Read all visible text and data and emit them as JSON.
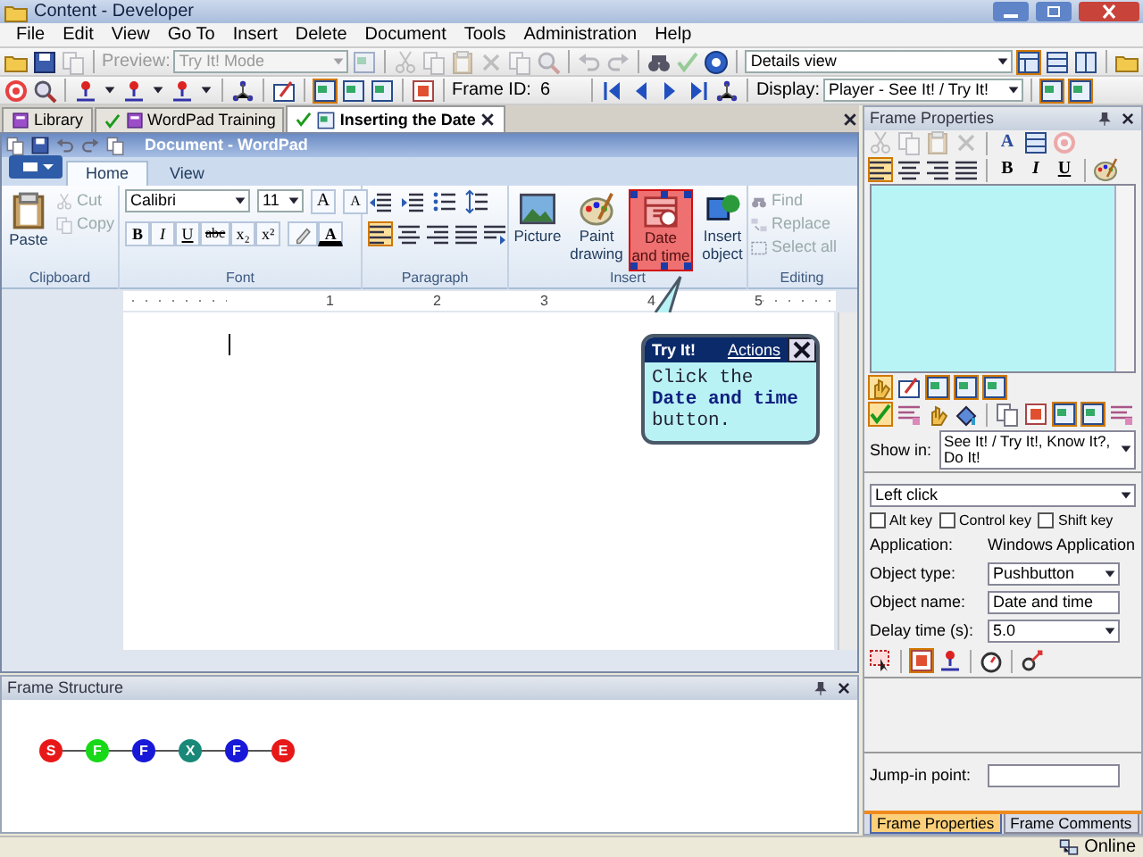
{
  "window": {
    "title": "Content - Developer"
  },
  "menu": [
    "File",
    "Edit",
    "View",
    "Go To",
    "Insert",
    "Delete",
    "Document",
    "Tools",
    "Administration",
    "Help"
  ],
  "toolbar": {
    "preview_label": {
      "text": "Preview:",
      "disabled": true
    },
    "mode_combo": {
      "value": "Try It! Mode",
      "disabled": true
    },
    "view_combo": {
      "value": "Details view",
      "disabled": false
    }
  },
  "frame_bar": {
    "frame_id_label": "Frame ID:",
    "frame_id": "6",
    "display_label": "Display:",
    "display_combo": "Player - See It! / Try It!"
  },
  "document_tabs": [
    {
      "label": "Library",
      "selected": false
    },
    {
      "label": "WordPad Training",
      "selected": false
    },
    {
      "label": "Inserting the Date",
      "selected": true
    }
  ],
  "wordpad": {
    "title": "Document - WordPad",
    "ribbon_tabs": [
      {
        "label": "Home",
        "selected": true
      },
      {
        "label": "View",
        "selected": false
      }
    ],
    "clipboard": {
      "label": "Clipboard",
      "paste": "Paste",
      "items": [
        {
          "label": "Cut",
          "disabled": true
        },
        {
          "label": "Copy",
          "disabled": true
        }
      ]
    },
    "font": {
      "label": "Font",
      "family": "Calibri",
      "size": "11",
      "size_buttons": [
        "A",
        "A"
      ],
      "format_buttons": [
        "B",
        "I",
        "U",
        "abc",
        "x₂",
        "x²"
      ],
      "color_button": "A"
    },
    "paragraph": {
      "label": "Paragraph",
      "align": [
        {
          "selected": true
        },
        {
          "selected": false
        },
        {
          "selected": false
        },
        {
          "selected": false
        }
      ]
    },
    "insert": {
      "label": "Insert",
      "items": [
        {
          "label": "Picture",
          "highlighted": false
        },
        {
          "label": "Paint drawing",
          "highlighted": false
        },
        {
          "label": "Date and time",
          "highlighted": true
        },
        {
          "label": "Insert object",
          "highlighted": false
        }
      ]
    },
    "editing": {
      "label": "Editing",
      "items": [
        {
          "label": "Find",
          "disabled": true
        },
        {
          "label": "Replace",
          "disabled": true
        },
        {
          "label": "Select all",
          "disabled": true
        }
      ]
    },
    "ruler_marks": [
      "1",
      "2",
      "3",
      "4",
      "5"
    ]
  },
  "callout": {
    "title": "Try It!",
    "link": "Actions",
    "text": "Click the **Date and time** button."
  },
  "frame_structure": {
    "title": "Frame Structure",
    "nodes": [
      {
        "label": "S",
        "color": "#e81818"
      },
      {
        "label": "F",
        "color": "#18d818"
      },
      {
        "label": "F",
        "color": "#1818d8"
      },
      {
        "label": "X",
        "color": "#188878"
      },
      {
        "label": "F",
        "color": "#1818d8"
      },
      {
        "label": "E",
        "color": "#e81818"
      }
    ]
  },
  "properties": {
    "title": "Frame Properties",
    "format_buttons": [
      "B",
      "I",
      "U"
    ],
    "text_button": "A",
    "show_in_label": "Show in:",
    "show_in": "See It! / Try It!, Know It?, Do It!",
    "action": "Left click",
    "keys": [
      {
        "label": "Alt key",
        "checked": false
      },
      {
        "label": "Control key",
        "checked": false
      },
      {
        "label": "Shift key",
        "checked": false
      }
    ],
    "application_label": "Application:",
    "application": "Windows Application",
    "fields": [
      {
        "label": "Object type:",
        "value": "Pushbutton",
        "kind": "combo"
      },
      {
        "label": "Object name:",
        "value": "Date and time",
        "kind": "text"
      },
      {
        "label": "Delay time (s):",
        "value": "5.0",
        "kind": "combo"
      }
    ],
    "jump_in_label": "Jump-in point:",
    "tabs": [
      {
        "label": "Frame Properties",
        "selected": true
      },
      {
        "label": "Frame Comments",
        "selected": false
      }
    ]
  },
  "status_bar": {
    "text": "Online"
  }
}
